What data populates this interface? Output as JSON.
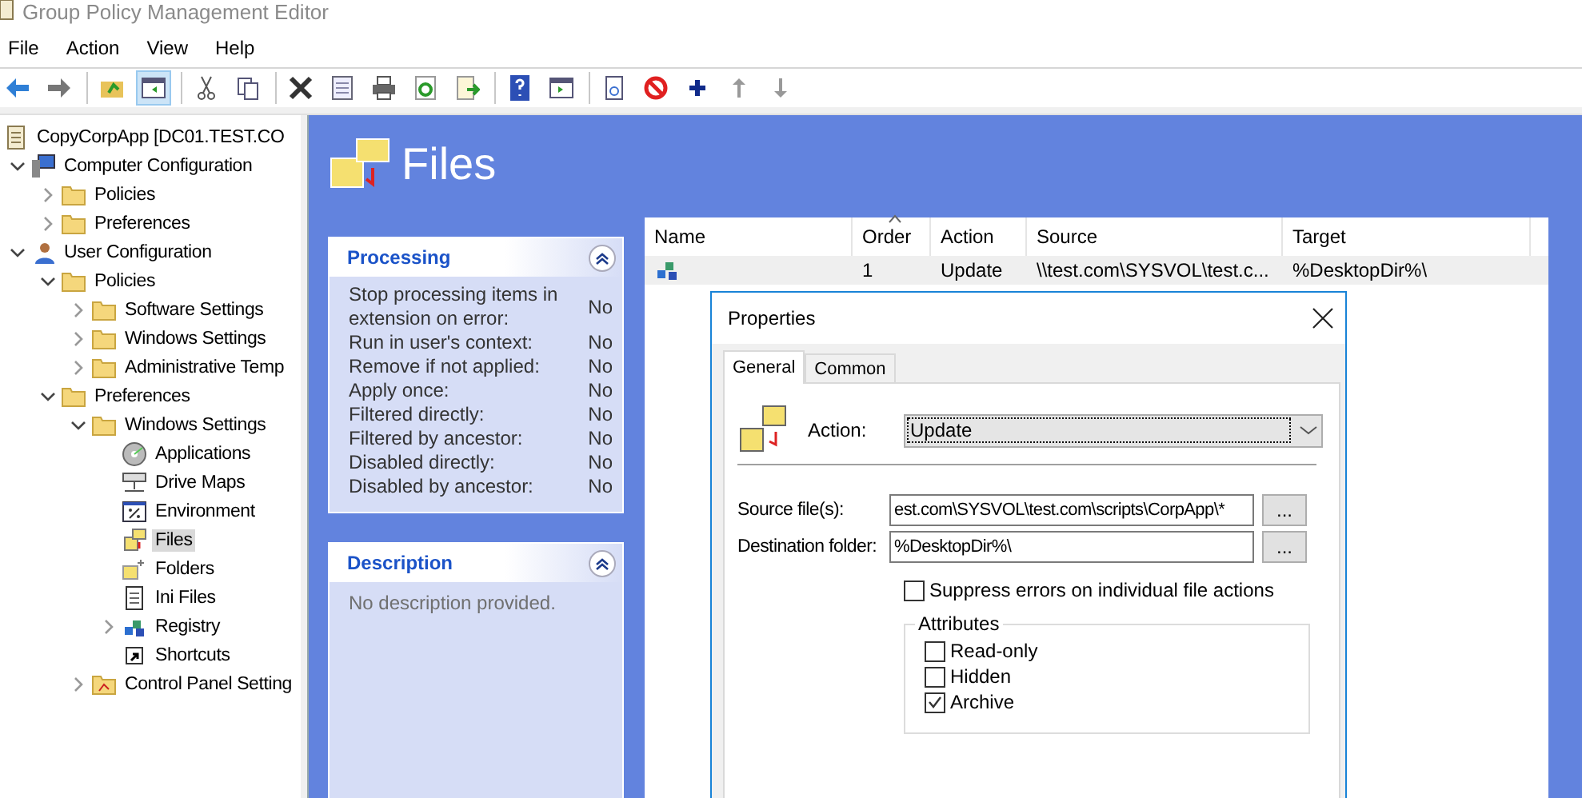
{
  "window": {
    "title": "Group Policy Management Editor"
  },
  "menu": [
    "File",
    "Action",
    "View",
    "Help"
  ],
  "toolbar_groups": [
    {
      "items": [
        {
          "kind": "back",
          "pressed": false
        },
        {
          "kind": "forward",
          "pressed": false
        }
      ]
    },
    {
      "items": [
        {
          "kind": "up-folder",
          "pressed": false
        },
        {
          "kind": "show-pane",
          "pressed": true
        }
      ]
    },
    {
      "items": [
        {
          "kind": "cut",
          "pressed": false
        },
        {
          "kind": "copy",
          "pressed": false
        }
      ]
    },
    {
      "items": [
        {
          "kind": "delete",
          "pressed": false
        },
        {
          "kind": "properties",
          "pressed": false
        },
        {
          "kind": "print",
          "pressed": false
        },
        {
          "kind": "refresh",
          "pressed": false
        },
        {
          "kind": "export",
          "pressed": false
        }
      ]
    },
    {
      "items": [
        {
          "kind": "help",
          "pressed": false
        },
        {
          "kind": "console",
          "pressed": false
        }
      ]
    },
    {
      "items": [
        {
          "kind": "new-doc",
          "pressed": false
        },
        {
          "kind": "block",
          "pressed": false
        },
        {
          "kind": "plus",
          "pressed": false
        },
        {
          "kind": "up",
          "pressed": false
        },
        {
          "kind": "down",
          "pressed": false
        }
      ]
    }
  ],
  "tree": [
    {
      "label": "CopyCorpApp [DC01.TEST.CO",
      "kind": "gpo",
      "selected": false,
      "children": [
        {
          "label": "Computer Configuration",
          "kind": "computer",
          "expanded": true,
          "selected": false,
          "children": [
            {
              "label": "Policies",
              "kind": "folder",
              "expanded": false,
              "selected": false
            },
            {
              "label": "Preferences",
              "kind": "folder",
              "expanded": false,
              "selected": false
            }
          ]
        },
        {
          "label": "User Configuration",
          "kind": "user",
          "expanded": true,
          "selected": false,
          "children": [
            {
              "label": "Policies",
              "kind": "folder",
              "expanded": true,
              "selected": false,
              "children": [
                {
                  "label": "Software Settings",
                  "kind": "folder",
                  "expanded": false,
                  "selected": false
                },
                {
                  "label": "Windows Settings",
                  "kind": "folder",
                  "expanded": false,
                  "selected": false
                },
                {
                  "label": "Administrative Temp",
                  "kind": "folder",
                  "expanded": false,
                  "selected": false
                }
              ]
            },
            {
              "label": "Preferences",
              "kind": "folder",
              "expanded": true,
              "selected": false,
              "children": [
                {
                  "label": "Windows Settings",
                  "kind": "folder",
                  "expanded": true,
                  "selected": false,
                  "children": [
                    {
                      "label": "Applications",
                      "kind": "applications",
                      "selected": false
                    },
                    {
                      "label": "Drive Maps",
                      "kind": "drive-maps",
                      "selected": false
                    },
                    {
                      "label": "Environment",
                      "kind": "environment",
                      "selected": false
                    },
                    {
                      "label": "Files",
                      "kind": "files",
                      "selected": true
                    },
                    {
                      "label": "Folders",
                      "kind": "folders",
                      "selected": false
                    },
                    {
                      "label": "Ini Files",
                      "kind": "ini",
                      "selected": false
                    },
                    {
                      "label": "Registry",
                      "kind": "registry",
                      "expanded": false,
                      "selected": false
                    },
                    {
                      "label": "Shortcuts",
                      "kind": "shortcuts",
                      "selected": false
                    }
                  ]
                },
                {
                  "label": "Control Panel Setting",
                  "kind": "control-panel",
                  "expanded": false,
                  "selected": false
                }
              ]
            }
          ]
        }
      ]
    }
  ],
  "header": {
    "title": "Files"
  },
  "processing": {
    "title": "Processing",
    "rows": [
      {
        "label": "Stop processing items in extension on error:",
        "value": "No"
      },
      {
        "label": "Run in user's context:",
        "value": "No"
      },
      {
        "label": "Remove if not applied:",
        "value": "No"
      },
      {
        "label": "Apply once:",
        "value": "No"
      },
      {
        "label": "Filtered directly:",
        "value": "No"
      },
      {
        "label": "Filtered by ancestor:",
        "value": "No"
      },
      {
        "label": "Disabled directly:",
        "value": "No"
      },
      {
        "label": "Disabled by ancestor:",
        "value": "No"
      }
    ]
  },
  "description": {
    "title": "Description",
    "text": "No description provided."
  },
  "table": {
    "columns": [
      "Name",
      "Order",
      "Action",
      "Source",
      "Target"
    ],
    "rows": [
      {
        "selected": true,
        "cells": [
          "",
          "1",
          "Update",
          "\\\\test.com\\SYSVOL\\test.c...",
          "%DesktopDir%\\"
        ]
      }
    ]
  },
  "dialog": {
    "title": "Properties",
    "tabs": [
      {
        "label": "General",
        "selected": true
      },
      {
        "label": "Common",
        "selected": false
      }
    ],
    "action_label": "Action:",
    "action_value": "Update",
    "source_label": "Source file(s):",
    "source_value": "est.com\\SYSVOL\\test.com\\scripts\\CorpApp\\*",
    "dest_label": "Destination folder:",
    "dest_value": "%DesktopDir%\\",
    "browse": "...",
    "suppress": {
      "label": "Suppress errors on individual file actions",
      "checked": false
    },
    "attributes": {
      "title": "Attributes",
      "items": [
        {
          "label": "Read-only",
          "checked": false
        },
        {
          "label": "Hidden",
          "checked": false
        },
        {
          "label": "Archive",
          "checked": true
        }
      ]
    }
  }
}
